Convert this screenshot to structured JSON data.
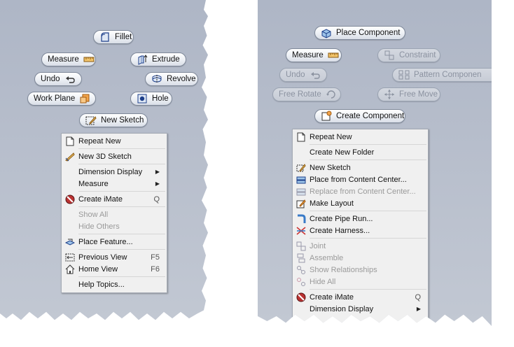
{
  "left": {
    "buttons": {
      "fillet": "Fillet",
      "measure": "Measure",
      "extrude": "Extrude",
      "undo": "Undo",
      "revolve": "Revolve",
      "work_plane": "Work Plane",
      "hole": "Hole",
      "new_sketch": "New Sketch"
    },
    "menu": {
      "repeat_new": "Repeat New",
      "new_3d_sketch": "New 3D Sketch",
      "dimension_display": "Dimension Display",
      "measure": "Measure",
      "create_imate": "Create iMate",
      "create_imate_shortcut": "Q",
      "show_all": "Show All",
      "hide_others": "Hide Others",
      "place_feature": "Place Feature...",
      "previous_view": "Previous View",
      "previous_view_shortcut": "F5",
      "home_view": "Home View",
      "home_view_shortcut": "F6",
      "help_topics": "Help Topics..."
    }
  },
  "right": {
    "buttons": {
      "place_component": "Place Component",
      "measure": "Measure",
      "constraint": "Constraint",
      "undo": "Undo",
      "pattern_component": "Pattern Componen",
      "free_rotate": "Free Rotate",
      "free_move": "Free Move",
      "create_component": "Create Component"
    },
    "menu": {
      "repeat_new": "Repeat New",
      "create_new_folder": "Create New Folder",
      "new_sketch": "New Sketch",
      "place_from_content_center": "Place from Content Center...",
      "replace_from_content_center": "Replace from Content Center...",
      "make_layout": "Make Layout",
      "create_pipe_run": "Create Pipe Run...",
      "create_harness": "Create Harness...",
      "joint": "Joint",
      "assemble": "Assemble",
      "show_relationships": "Show Relationships",
      "hide_all": "Hide All",
      "create_imate": "Create iMate",
      "create_imate_shortcut": "Q",
      "dimension_display": "Dimension Display"
    }
  }
}
